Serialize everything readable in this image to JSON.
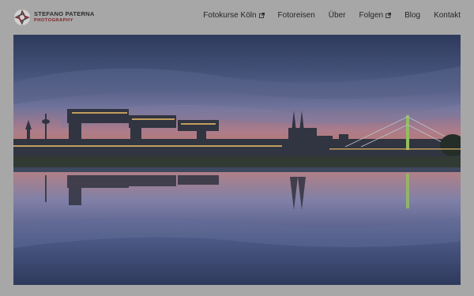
{
  "site": {
    "logo_name": "STEFANO PATERNA",
    "logo_sub": "PHOTOGRAPHY"
  },
  "nav": {
    "items": [
      {
        "label": "Fotokurse Köln",
        "external": true
      },
      {
        "label": "Fotoreisen",
        "external": false
      },
      {
        "label": "Über",
        "external": false
      },
      {
        "label": "Folgen",
        "external": true
      },
      {
        "label": "Blog",
        "external": false
      },
      {
        "label": "Kontakt",
        "external": false
      }
    ]
  },
  "colors": {
    "header_bg": "#bfbfbf",
    "brand_red": "#8e1f24",
    "nav_text": "#1f1f1f"
  },
  "hero": {
    "icons": [
      "external-link-icon"
    ]
  }
}
